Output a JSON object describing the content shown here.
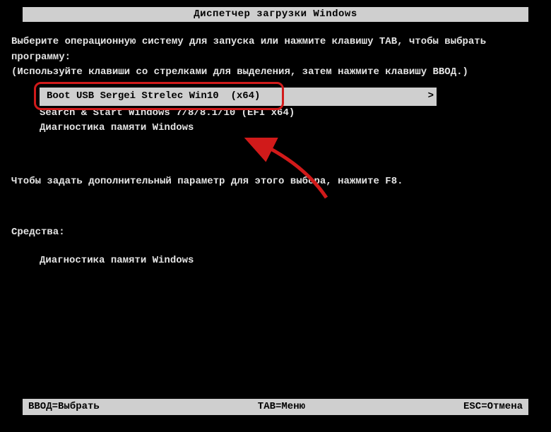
{
  "title": "Диспетчер загрузки Windows",
  "instruction_line1": "Выберите операционную систему для запуска или нажмите клавишу TAB, чтобы выбрать",
  "instruction_line2": "программу:",
  "instruction_line3": "(Используйте клавиши со стрелками для выделения, затем нажмите клавишу ВВОД.)",
  "bootOptions": {
    "selected": "Boot USB Sergei Strelec Win10  (x64)",
    "option2": "Search & Start Windows 7/8/8.1/10 (EFI x64)",
    "option3": "Диагностика памяти Windows"
  },
  "f8_hint": "Чтобы задать дополнительный параметр для этого выбора, нажмите F8.",
  "tools_title": "Средства:",
  "tools_item1": "Диагностика памяти Windows",
  "footer": {
    "left": "ВВОД=Выбрать",
    "center": "TAB=Меню",
    "right": "ESC=Отмена"
  }
}
